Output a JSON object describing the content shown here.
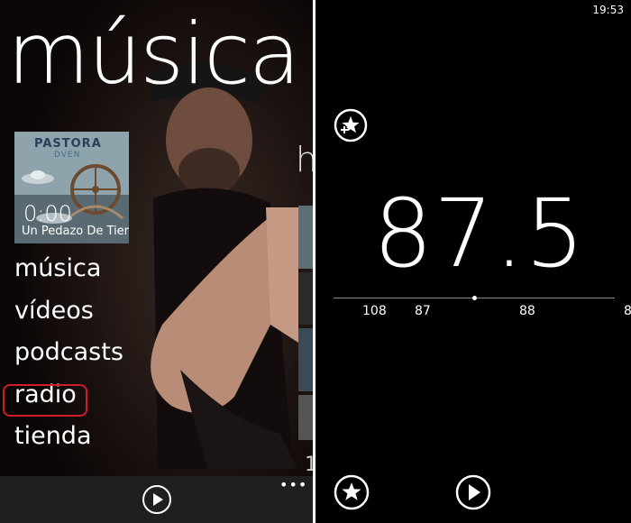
{
  "left_pane": {
    "hub_title": "música",
    "next_panel_peek": "h",
    "now_playing": {
      "album_artist": "PASTORA",
      "album_subtitle": "DVEN",
      "elapsed": "0:00",
      "song_title": "Un Pedazo De Tier"
    },
    "menu": [
      {
        "label": "música",
        "selected": false
      },
      {
        "label": "vídeos",
        "selected": false
      },
      {
        "label": "podcasts",
        "selected": false
      },
      {
        "label": "radio",
        "selected": true
      },
      {
        "label": "tienda",
        "selected": false
      }
    ],
    "bottom_peek_char": "1",
    "more_label": "•••",
    "highlight_color": "#d21b2b"
  },
  "right_pane": {
    "clock": "19:53",
    "frequency": "87.5",
    "dial_labels": [
      "108",
      "87",
      "88",
      "8"
    ],
    "icons": {
      "top": "add-favorite-icon",
      "bottom_left": "star-icon",
      "bottom_center": "play-icon"
    }
  }
}
